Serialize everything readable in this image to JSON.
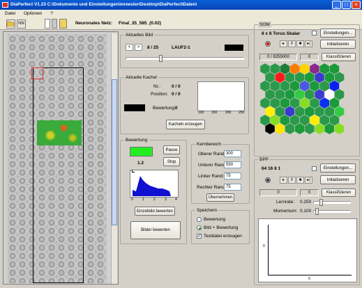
{
  "window": {
    "title": "DiaPerfect V1.23  C:\\Dokumente und Einstellungen\\mreester\\Desktop\\DiaPerfect\\Daten\\",
    "min": "_",
    "max": "□",
    "close": "×"
  },
  "menu": {
    "items": [
      "Datei",
      "Optionen",
      "?"
    ]
  },
  "toolbar": {
    "nn_label": "NN",
    "net_label": "Neuronales Netz:",
    "net_name": "Final_35_585_(0.02)"
  },
  "aktuelles_bild": {
    "title": "Aktuelles Bild",
    "prev": "<",
    "next": ">",
    "counter": "8 / 25",
    "name": "LAUF2-1"
  },
  "aktuelle_kachel": {
    "title": "Aktuelle Kachel",
    "nr_label": "Nr.:",
    "nr_value": "0 / 0",
    "pos_label": "Position:",
    "pos_value": "0 / 0",
    "bew_label": "Bewertung:",
    "bew_value": "0",
    "button": "Kacheln erzeugen",
    "hist_ticks": [
      "100",
      "150",
      "200",
      "250"
    ]
  },
  "bewertung": {
    "title": "Bewertung",
    "value": "1.2",
    "pause": "Pause",
    "stop": "Stop",
    "hist_ticks": [
      "0",
      "1",
      "2",
      "3",
      "4"
    ],
    "einzel": "Einzelbild bewerten",
    "bilder": "Bilder bewerten"
  },
  "kernbereich": {
    "title": "Kernbereich",
    "oberer_label": "Oberer Rand:",
    "oberer": "300",
    "unterer_label": "Unterer Rand:",
    "unterer": "550",
    "linker_label": "Linker Rand:",
    "linker": "75",
    "rechter_label": "Rechter Rand:",
    "rechter": "75",
    "button": "Übernehmen"
  },
  "speichern": {
    "title": "Speichern",
    "opt1": "Bewertung",
    "opt2": "Bild + Bewertung",
    "opt3": "Textdatei erzeugen"
  },
  "som": {
    "title": "SOM",
    "config": "8 x 8  Torus  Skalar",
    "einst": "Einstellungen...",
    "init": "Initialisieren",
    "counter": "0 / 8255000",
    "counter2": "0",
    "klass": "Klassifizieren",
    "colors": [
      "#2a9a4a",
      "#2a9a4a",
      "#1e7d3a",
      "#ff7a00",
      "#ffd400",
      "#8a2a8a",
      "#1a9a3a",
      "#1a9a3a",
      "#2a9a4a",
      "#ff1a1a",
      "#2a9a4a",
      "#2a9a4a",
      "#1a9a3a",
      "#3a3ad0",
      "#1a9a3a",
      "#2a9a4a",
      "#2a9a4a",
      "#2a9a4a",
      "#2a9a4a",
      "#1a9a3a",
      "#4a5ae0",
      "#1a9a3a",
      "#2a9a4a",
      "#0a20f0",
      "#2a9a4a",
      "#2a9a4a",
      "#1a9a3a",
      "#33cc44",
      "#2a9a4a",
      "#3b3bd4",
      "#ffffff",
      "#2a9a4a",
      "#2a9a4a",
      "#2a9a4a",
      "#1a9a3a",
      "#2a9a4a",
      "#88dd22",
      "#2a9a4a",
      "#0a30f0",
      "#1a9a3a",
      "#fff000",
      "#2a9a4a",
      "#3a3ad0",
      "#2a9a4a",
      "#1a9a3a",
      "#2a9a4a",
      "#2a9a4a",
      "#33cc44",
      "#2a9a4a",
      "#88dd22",
      "#1a9a3a",
      "#2a9a4a",
      "#2a9a4a",
      "#ffee00",
      "#2a9a4a",
      "#2a9a4a",
      "#000000",
      "#ffe600",
      "#2a9a4a",
      "#1a9a3a",
      "#2a9a4a",
      "#88dd22",
      "#1a9a3a",
      "#88dd22"
    ]
  },
  "bpp": {
    "title": "BPP",
    "config": "64  16  8  1",
    "einst": "Einstellungen...",
    "init": "Initialisieren",
    "c1": "0",
    "c2": "0",
    "klass": "Klassifizieren",
    "lernrate_label": "Lernrate:",
    "lernrate": "0.250",
    "momentum_label": "Momentum:",
    "momentum": "0.100",
    "plot_y0": "0",
    "plot_x0": "0"
  }
}
